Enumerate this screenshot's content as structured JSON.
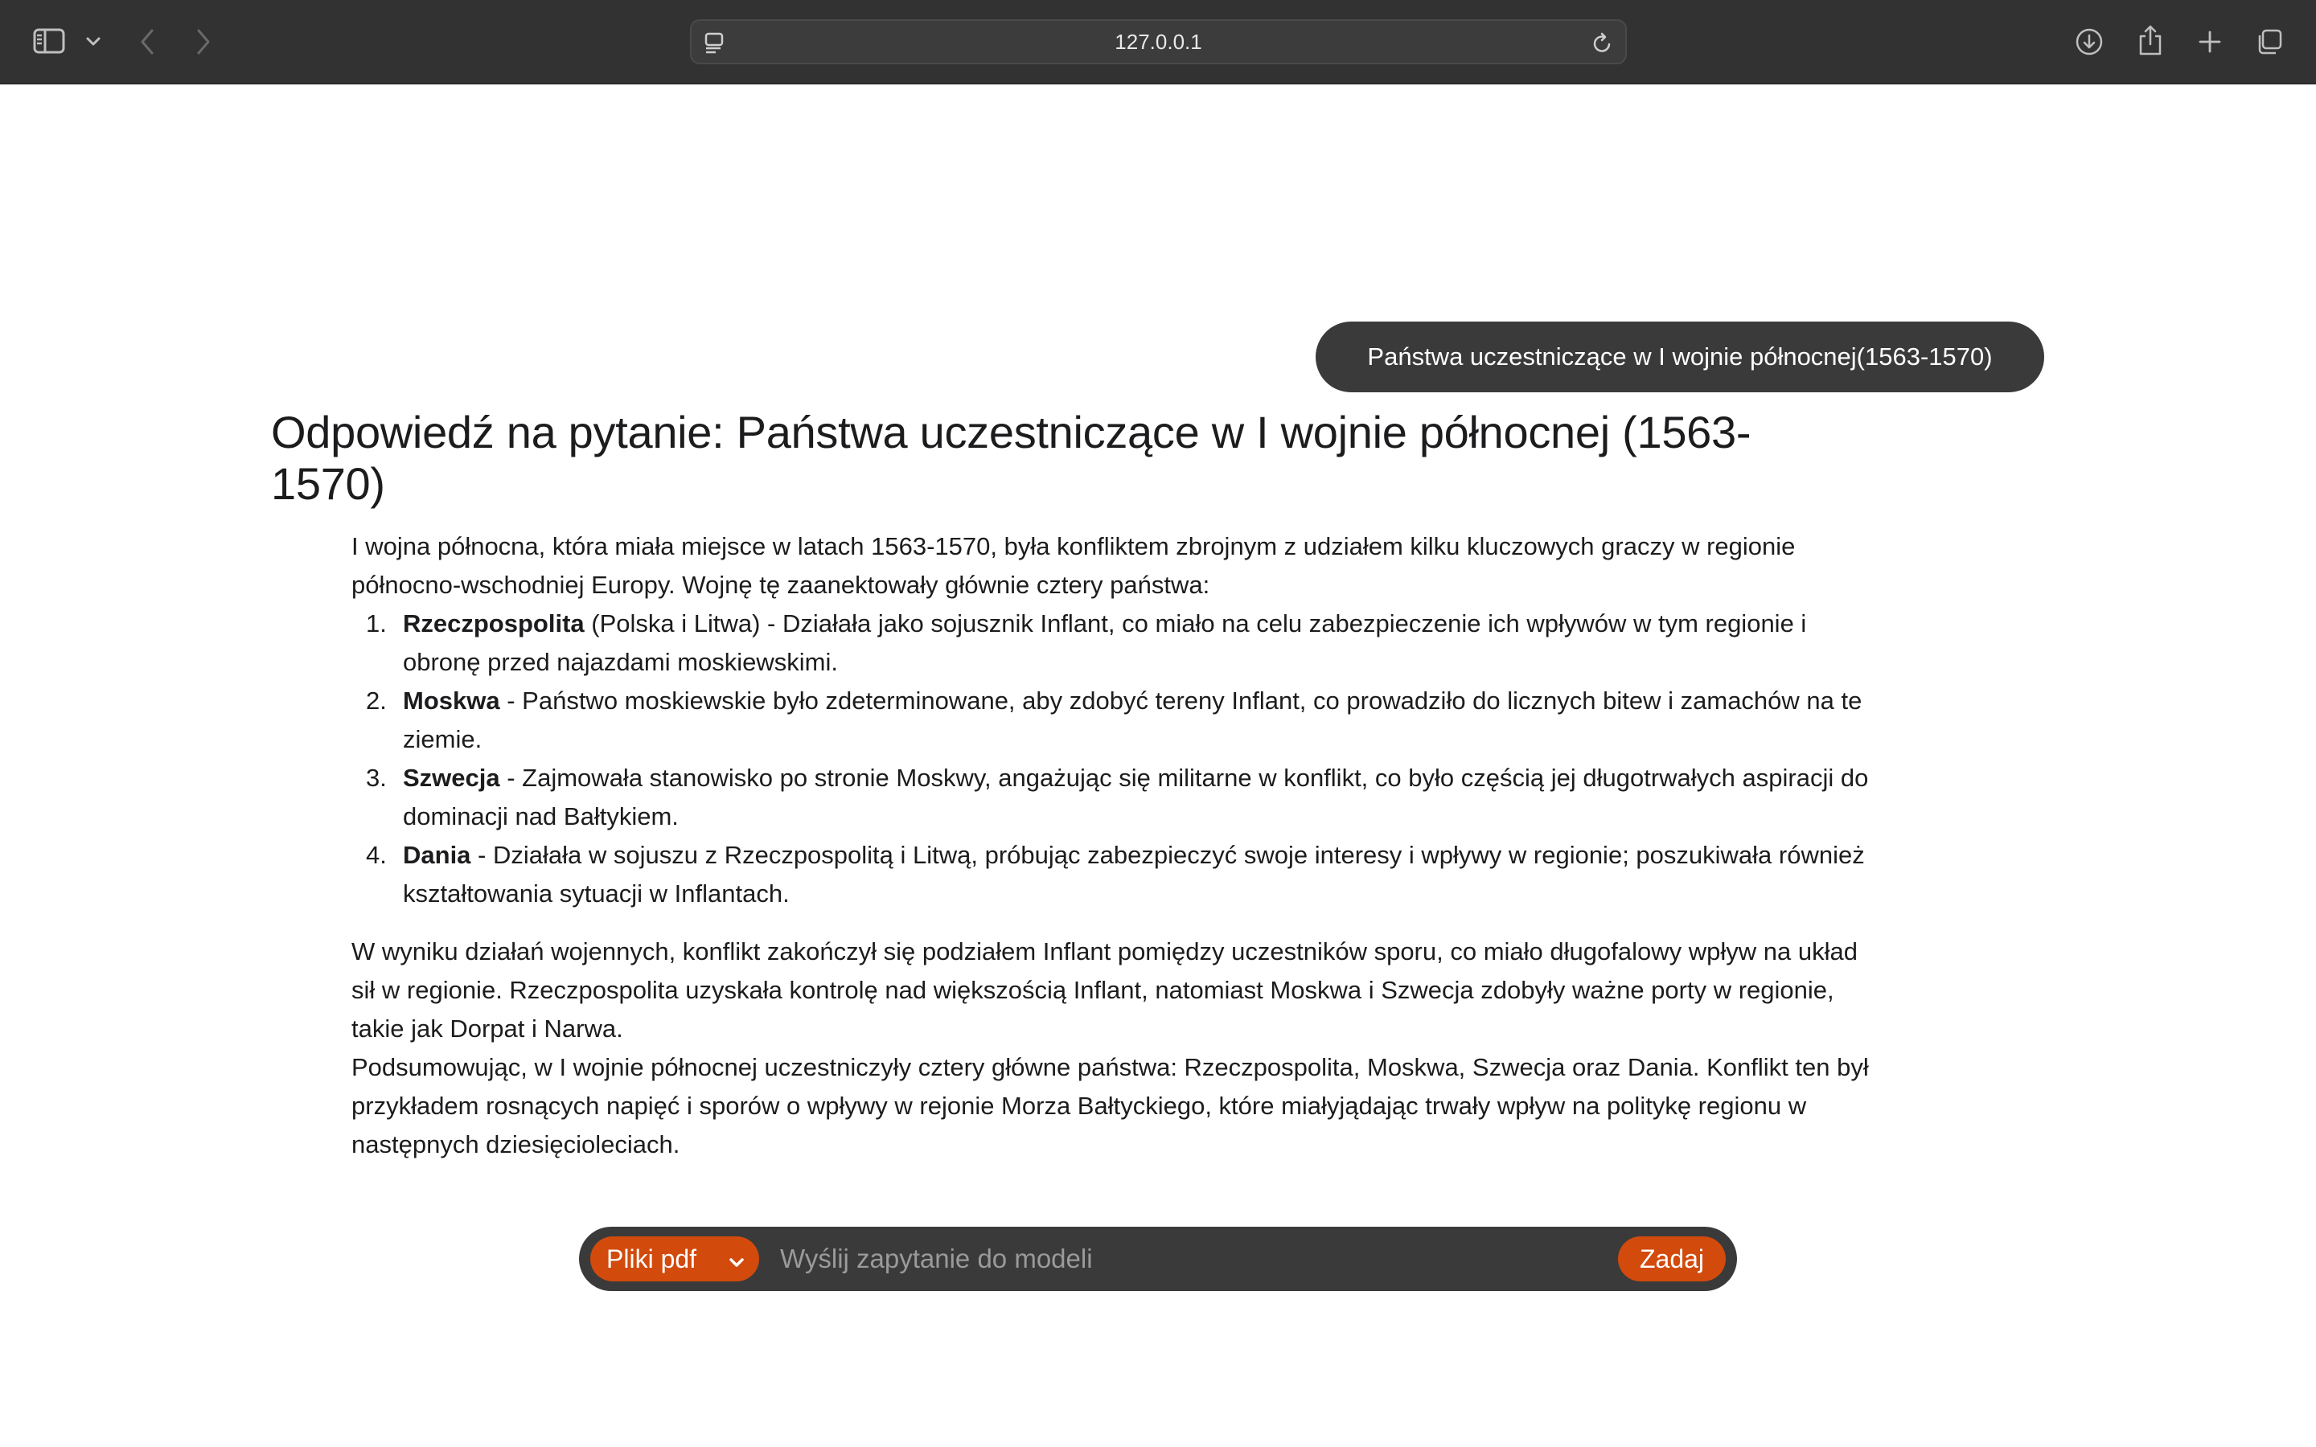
{
  "browser": {
    "url": "127.0.0.1"
  },
  "chat": {
    "user_question": "Państwa uczestniczące w I wojnie północnej(1563-1570)",
    "answer_title": "Odpowiedź na pytanie: Państwa uczestniczące w I wojnie północnej (1563-1570)",
    "intro": "I wojna północna, która miała miejsce w latach 1563-1570, była konfliktem zbrojnym z udziałem kilku kluczowych graczy w regionie północno-wschodniej Europy. Wojnę tę zaanektowały głównie cztery państwa:",
    "list": [
      {
        "num": "1.",
        "name": "Rzeczpospolita",
        "text": " (Polska i Litwa) - Działała jako sojusznik Inflant, co miało na celu zabezpieczenie ich wpływów w tym regionie i obronę przed najazdami moskiewskimi."
      },
      {
        "num": "2.",
        "name": "Moskwa",
        "text": " - Państwo moskiewskie było zdeterminowane, aby zdobyć tereny Inflant, co prowadziło do licznych bitew i zamachów na te ziemie."
      },
      {
        "num": "3.",
        "name": "Szwecja",
        "text": " - Zajmowała stanowisko po stronie Moskwy, angażując się militarne w konflikt, co było częścią jej długotrwałych aspiracji do dominacji nad Bałtykiem."
      },
      {
        "num": "4.",
        "name": "Dania",
        "text": " - Działała w sojuszu z Rzeczpospolitą i Litwą, próbując zabezpieczyć swoje interesy i wpływy w regionie; poszukiwała również kształtowania sytuacji w Inflantach."
      }
    ],
    "outcome": "W wyniku działań wojennych, konflikt zakończył się podziałem Inflant pomiędzy uczestników sporu, co miało długofalowy wpływ na układ sił w regionie. Rzeczpospolita uzyskała kontrolę nad większością Inflant, natomiast Moskwa i Szwecja zdobyły ważne porty w regionie, takie jak Dorpat i Narwa.",
    "summary": "Podsumowując, w I wojnie północnej uczestniczyły cztery główne państwa: Rzeczpospolita, Moskwa, Szwecja oraz Dania. Konflikt ten był przykładem rosnących napięć i sporów o wpływy w rejonie Morza Bałtyckiego, które miałyjądając trwały wpływ na politykę regionu w następnych dziesięcioleciach."
  },
  "input_bar": {
    "source_select": "Pliki pdf",
    "placeholder": "Wyślij zapytanie do modeli",
    "submit_label": "Zadaj"
  },
  "colors": {
    "accent": "#d24a0c",
    "bar_bg": "#3a3a3a",
    "chrome_bg": "#323233"
  }
}
